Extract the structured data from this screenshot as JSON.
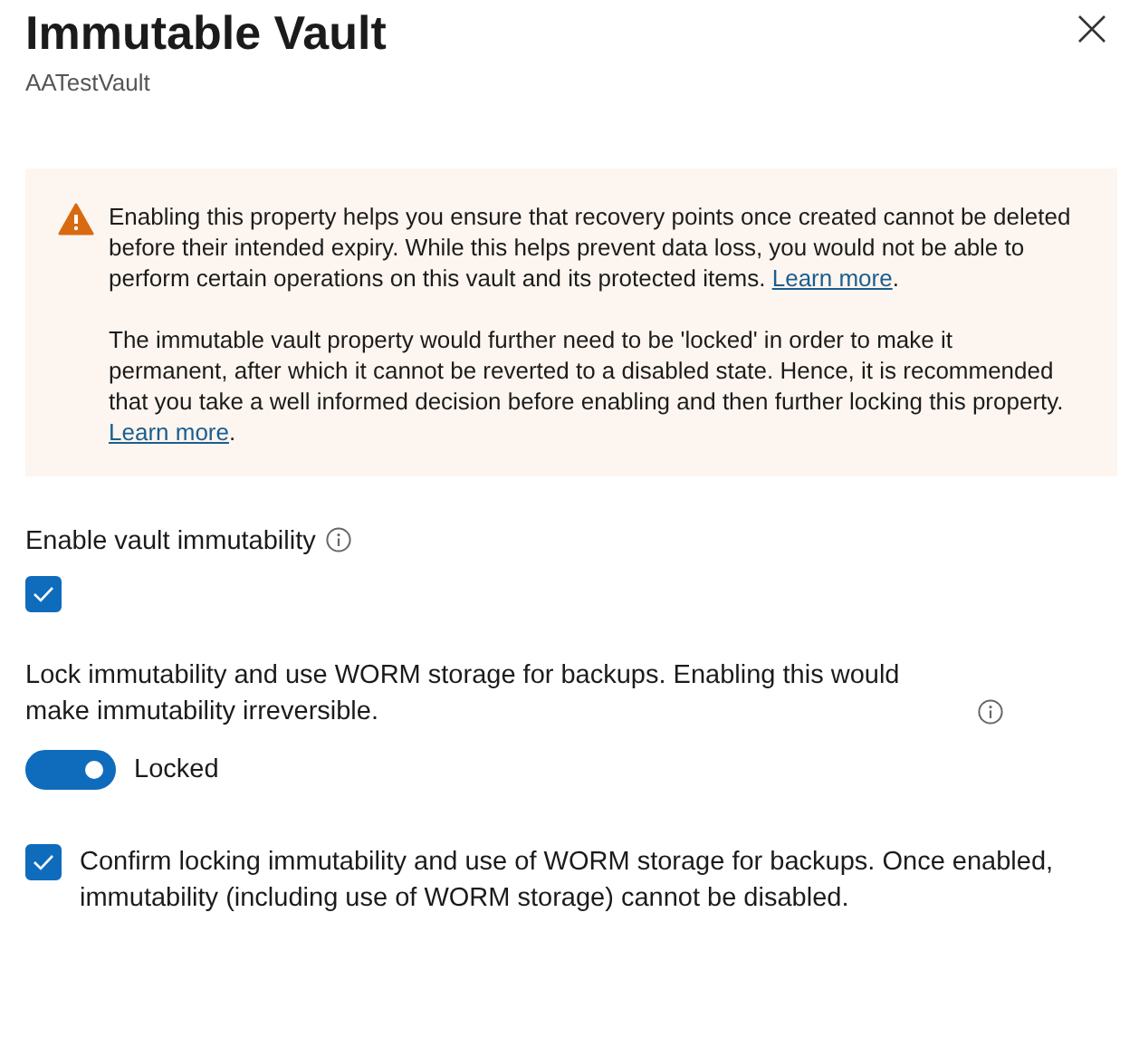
{
  "header": {
    "title": "Immutable Vault",
    "subtitle": "AATestVault"
  },
  "warning": {
    "paragraphs": [
      {
        "text": "Enabling this property helps you ensure that recovery points once created cannot be deleted before their intended expiry. While this helps prevent data loss, you would not be able to perform certain operations on this vault and its protected items. ",
        "link": "Learn more",
        "after": "."
      },
      {
        "text": "The immutable vault property would further need to be 'locked' in order to make it permanent, after which it cannot be reverted to a disabled state. Hence, it is recommended that you take a well informed decision before enabling and then further locking this property. ",
        "link": "Learn more",
        "after": "."
      }
    ]
  },
  "immutability": {
    "label": "Enable vault immutability",
    "checked": true
  },
  "lock": {
    "label": "Lock immutability and use WORM storage for backups. Enabling this would make immutability irreversible.",
    "on": true,
    "state_label": "Locked"
  },
  "confirm": {
    "label": "Confirm locking immutability and use of WORM storage for backups. Once enabled, immutability (including use of WORM storage) cannot be disabled.",
    "checked": true
  }
}
